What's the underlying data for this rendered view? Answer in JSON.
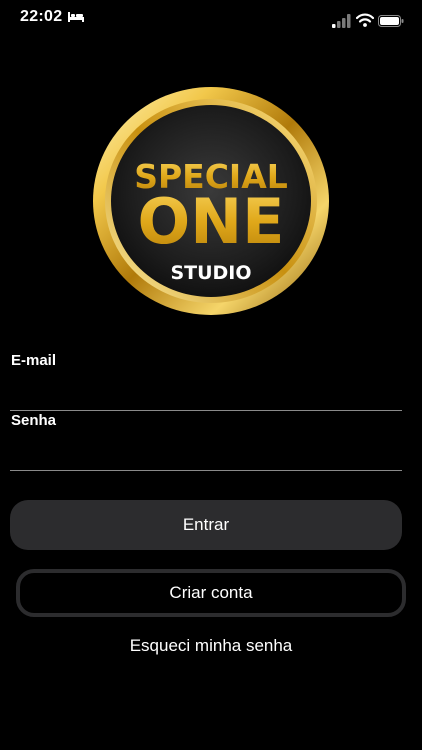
{
  "status_bar": {
    "time": "22:02",
    "icons": [
      "bed-icon",
      "signal-icon",
      "wifi-icon",
      "battery-icon"
    ]
  },
  "logo": {
    "line1": "SPECIAL",
    "line2": "ONE",
    "line3": "STUDIO"
  },
  "form": {
    "email_label": "E-mail",
    "email_value": "",
    "password_label": "Senha",
    "password_value": ""
  },
  "buttons": {
    "login_label": "Entrar",
    "create_account_label": "Criar conta",
    "forgot_password_label": "Esqueci minha senha"
  },
  "colors": {
    "background": "#000000",
    "button_fill": "#2c2c2e",
    "gold_light": "#f7e08a",
    "gold_mid": "#d4a017",
    "gold_dark": "#8a5a00",
    "text": "#ffffff"
  }
}
